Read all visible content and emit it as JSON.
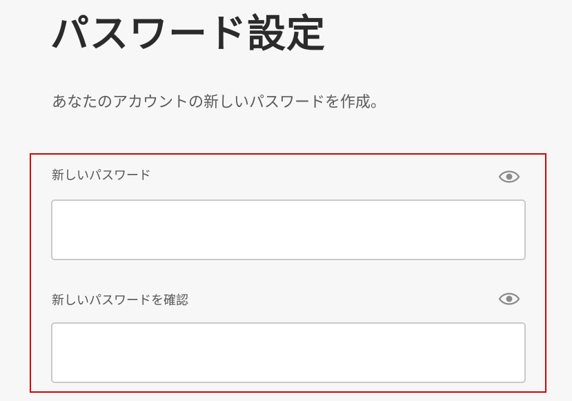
{
  "page": {
    "title": "パスワード設定",
    "subtitle": "あなたのアカウントの新しいパスワードを作成。"
  },
  "form": {
    "new_password": {
      "label": "新しいパスワード",
      "value": "",
      "toggle_icon": "eye-icon"
    },
    "confirm_password": {
      "label": "新しいパスワードを確認",
      "value": "",
      "toggle_icon": "eye-icon"
    }
  },
  "colors": {
    "highlight_border": "#d40000",
    "background": "#f7f7f7",
    "title_text": "#2b2b2b",
    "input_border": "#c9c9c9"
  }
}
